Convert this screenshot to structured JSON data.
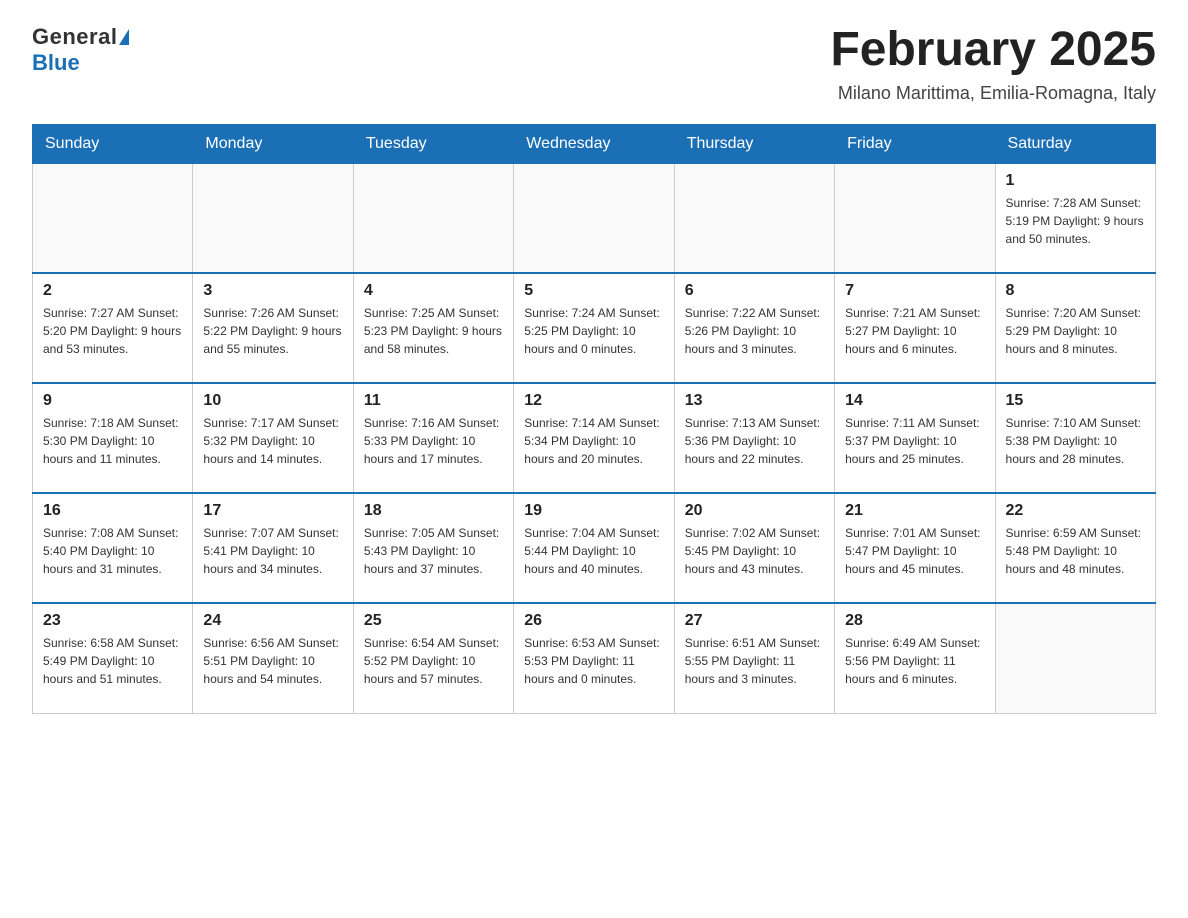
{
  "header": {
    "logo": {
      "general": "General",
      "triangle": "▶",
      "blue": "Blue"
    },
    "title": "February 2025",
    "location": "Milano Marittima, Emilia-Romagna, Italy"
  },
  "weekdays": [
    "Sunday",
    "Monday",
    "Tuesday",
    "Wednesday",
    "Thursday",
    "Friday",
    "Saturday"
  ],
  "weeks": [
    [
      {
        "day": "",
        "info": ""
      },
      {
        "day": "",
        "info": ""
      },
      {
        "day": "",
        "info": ""
      },
      {
        "day": "",
        "info": ""
      },
      {
        "day": "",
        "info": ""
      },
      {
        "day": "",
        "info": ""
      },
      {
        "day": "1",
        "info": "Sunrise: 7:28 AM\nSunset: 5:19 PM\nDaylight: 9 hours and 50 minutes."
      }
    ],
    [
      {
        "day": "2",
        "info": "Sunrise: 7:27 AM\nSunset: 5:20 PM\nDaylight: 9 hours and 53 minutes."
      },
      {
        "day": "3",
        "info": "Sunrise: 7:26 AM\nSunset: 5:22 PM\nDaylight: 9 hours and 55 minutes."
      },
      {
        "day": "4",
        "info": "Sunrise: 7:25 AM\nSunset: 5:23 PM\nDaylight: 9 hours and 58 minutes."
      },
      {
        "day": "5",
        "info": "Sunrise: 7:24 AM\nSunset: 5:25 PM\nDaylight: 10 hours and 0 minutes."
      },
      {
        "day": "6",
        "info": "Sunrise: 7:22 AM\nSunset: 5:26 PM\nDaylight: 10 hours and 3 minutes."
      },
      {
        "day": "7",
        "info": "Sunrise: 7:21 AM\nSunset: 5:27 PM\nDaylight: 10 hours and 6 minutes."
      },
      {
        "day": "8",
        "info": "Sunrise: 7:20 AM\nSunset: 5:29 PM\nDaylight: 10 hours and 8 minutes."
      }
    ],
    [
      {
        "day": "9",
        "info": "Sunrise: 7:18 AM\nSunset: 5:30 PM\nDaylight: 10 hours and 11 minutes."
      },
      {
        "day": "10",
        "info": "Sunrise: 7:17 AM\nSunset: 5:32 PM\nDaylight: 10 hours and 14 minutes."
      },
      {
        "day": "11",
        "info": "Sunrise: 7:16 AM\nSunset: 5:33 PM\nDaylight: 10 hours and 17 minutes."
      },
      {
        "day": "12",
        "info": "Sunrise: 7:14 AM\nSunset: 5:34 PM\nDaylight: 10 hours and 20 minutes."
      },
      {
        "day": "13",
        "info": "Sunrise: 7:13 AM\nSunset: 5:36 PM\nDaylight: 10 hours and 22 minutes."
      },
      {
        "day": "14",
        "info": "Sunrise: 7:11 AM\nSunset: 5:37 PM\nDaylight: 10 hours and 25 minutes."
      },
      {
        "day": "15",
        "info": "Sunrise: 7:10 AM\nSunset: 5:38 PM\nDaylight: 10 hours and 28 minutes."
      }
    ],
    [
      {
        "day": "16",
        "info": "Sunrise: 7:08 AM\nSunset: 5:40 PM\nDaylight: 10 hours and 31 minutes."
      },
      {
        "day": "17",
        "info": "Sunrise: 7:07 AM\nSunset: 5:41 PM\nDaylight: 10 hours and 34 minutes."
      },
      {
        "day": "18",
        "info": "Sunrise: 7:05 AM\nSunset: 5:43 PM\nDaylight: 10 hours and 37 minutes."
      },
      {
        "day": "19",
        "info": "Sunrise: 7:04 AM\nSunset: 5:44 PM\nDaylight: 10 hours and 40 minutes."
      },
      {
        "day": "20",
        "info": "Sunrise: 7:02 AM\nSunset: 5:45 PM\nDaylight: 10 hours and 43 minutes."
      },
      {
        "day": "21",
        "info": "Sunrise: 7:01 AM\nSunset: 5:47 PM\nDaylight: 10 hours and 45 minutes."
      },
      {
        "day": "22",
        "info": "Sunrise: 6:59 AM\nSunset: 5:48 PM\nDaylight: 10 hours and 48 minutes."
      }
    ],
    [
      {
        "day": "23",
        "info": "Sunrise: 6:58 AM\nSunset: 5:49 PM\nDaylight: 10 hours and 51 minutes."
      },
      {
        "day": "24",
        "info": "Sunrise: 6:56 AM\nSunset: 5:51 PM\nDaylight: 10 hours and 54 minutes."
      },
      {
        "day": "25",
        "info": "Sunrise: 6:54 AM\nSunset: 5:52 PM\nDaylight: 10 hours and 57 minutes."
      },
      {
        "day": "26",
        "info": "Sunrise: 6:53 AM\nSunset: 5:53 PM\nDaylight: 11 hours and 0 minutes."
      },
      {
        "day": "27",
        "info": "Sunrise: 6:51 AM\nSunset: 5:55 PM\nDaylight: 11 hours and 3 minutes."
      },
      {
        "day": "28",
        "info": "Sunrise: 6:49 AM\nSunset: 5:56 PM\nDaylight: 11 hours and 6 minutes."
      },
      {
        "day": "",
        "info": ""
      }
    ]
  ]
}
